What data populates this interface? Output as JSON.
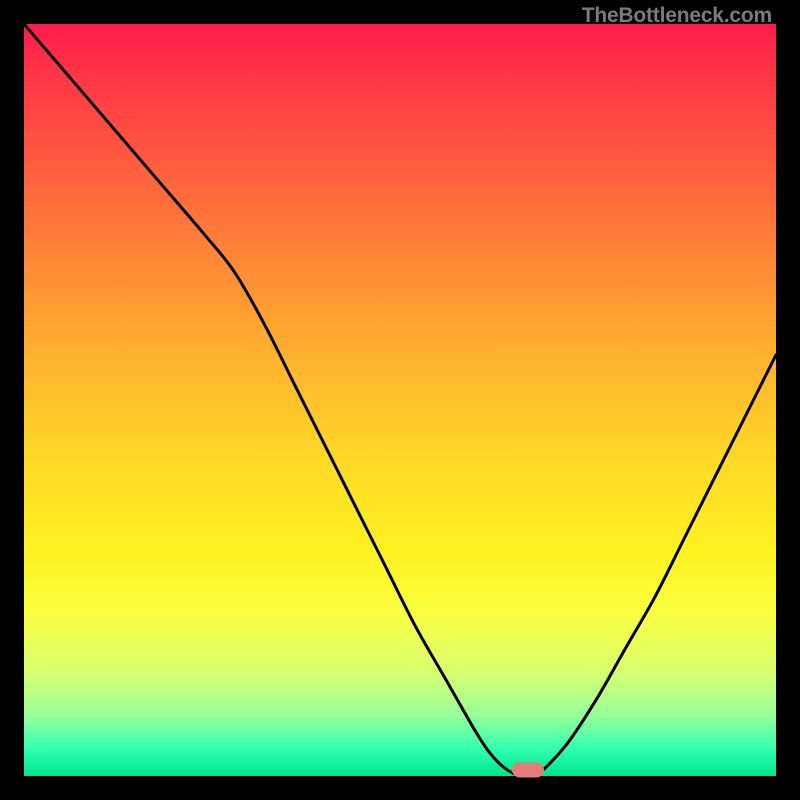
{
  "watermark": "TheBottleneck.com",
  "chart_data": {
    "type": "line",
    "title": "",
    "xlabel": "",
    "ylabel": "",
    "xlim": [
      0,
      100
    ],
    "ylim": [
      0,
      100
    ],
    "x": [
      0,
      6,
      12,
      18,
      24,
      28,
      32,
      36,
      40,
      44,
      48,
      52,
      56,
      60,
      62,
      64,
      66,
      68,
      72,
      76,
      80,
      84,
      88,
      92,
      96,
      100
    ],
    "values": [
      100,
      93,
      86,
      79,
      72,
      67,
      60,
      52,
      44,
      36,
      28,
      20,
      13,
      6,
      3,
      1,
      0,
      0,
      4,
      10,
      17,
      24,
      32,
      40,
      48,
      56
    ],
    "optimum_x": 67,
    "grid": false,
    "legend": false
  },
  "gradient_stops": [
    {
      "pct": 0,
      "color": "#ff1b4a"
    },
    {
      "pct": 18,
      "color": "#ff5a3f"
    },
    {
      "pct": 45,
      "color": "#ffb42e"
    },
    {
      "pct": 70,
      "color": "#fff122"
    },
    {
      "pct": 92,
      "color": "#97ff9a"
    },
    {
      "pct": 100,
      "color": "#00e58a"
    }
  ]
}
